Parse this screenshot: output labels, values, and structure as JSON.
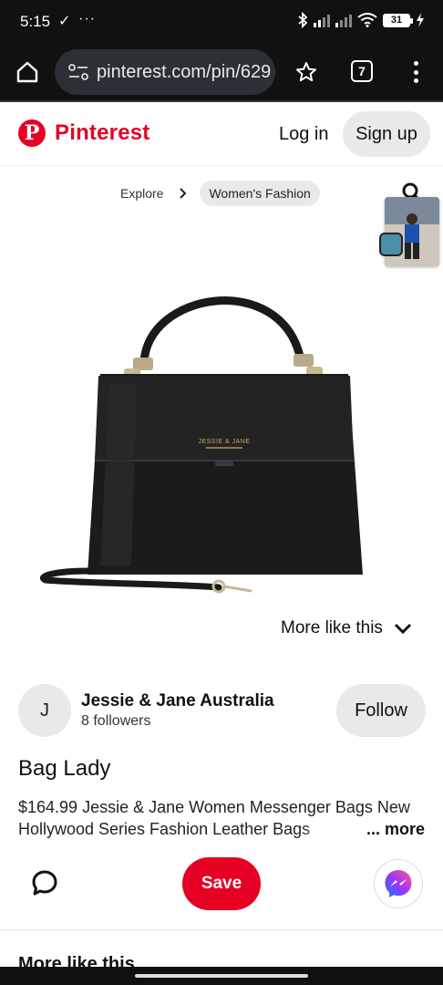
{
  "status_bar": {
    "time": "5:15",
    "check_icon": "check-download-icon",
    "more_dots": "···",
    "battery": "31",
    "icons": [
      "bluetooth-icon",
      "signal-icon",
      "signal-icon",
      "wifi-icon",
      "battery-icon",
      "charging-icon"
    ]
  },
  "browser": {
    "url": "pinterest.com/pin/629",
    "tab_count": "7",
    "icons": [
      "home-icon",
      "site-settings-icon",
      "star-icon",
      "tabs-icon",
      "more-vert-icon"
    ]
  },
  "header": {
    "logo_text": "Pinterest",
    "login_label": "Log in",
    "signup_label": "Sign up",
    "brand_color": "#e60023"
  },
  "breadcrumb": {
    "items": [
      "Explore",
      "Women's Fashion"
    ]
  },
  "product": {
    "brand_stamp": "JESSIE & JANE",
    "icons": [
      "search-icon"
    ]
  },
  "more_like_this": {
    "toggle_label": "More like this",
    "heading": "More like this"
  },
  "creator": {
    "initial": "J",
    "name": "Jessie & Jane Australia",
    "followers": "8 followers",
    "follow_label": "Follow"
  },
  "pin": {
    "title": "Bag Lady",
    "description": "$164.99 Jessie & Jane Women Messenger Bags New Hollywood Series Fashion Leather Bags",
    "more_label": "... more"
  },
  "actions": {
    "save_label": "Save",
    "icons": [
      "comment-icon",
      "messenger-icon"
    ]
  }
}
